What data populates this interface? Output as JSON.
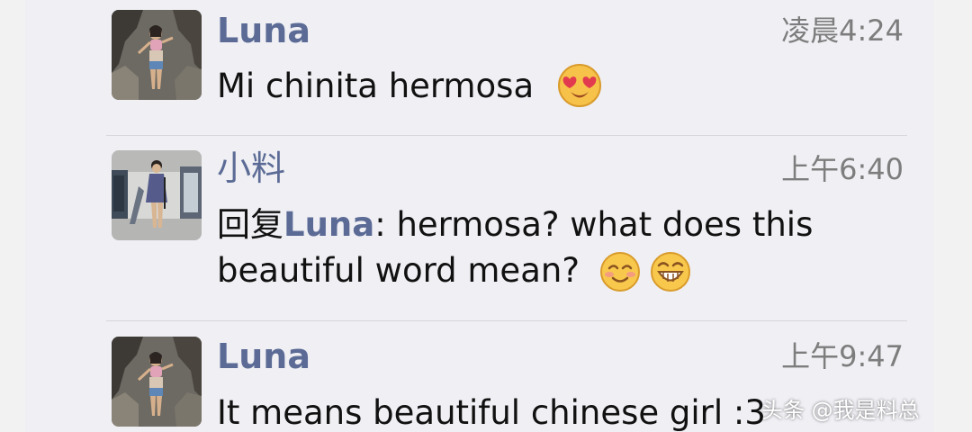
{
  "comments": [
    {
      "author": "Luna",
      "time": "凌晨4:24",
      "text": "Mi chinita hermosa",
      "emojis": [
        "heart-eyes-emoji"
      ]
    },
    {
      "author": "小料",
      "time": "上午6:40",
      "reply_prefix": "回复",
      "reply_to": "Luna",
      "text": ": hermosa?  what does this beautiful word mean?",
      "emojis": [
        "blushing-smile-emoji",
        "grinning-emoji"
      ]
    },
    {
      "author": "Luna",
      "time": "上午9:47",
      "text": "It means beautiful chinese girl :3",
      "emojis": []
    }
  ],
  "watermark": "头条 @我是料总",
  "colors": {
    "background": "#efeff4",
    "name": "#5b6b95",
    "time": "#7d7d7d",
    "text": "#111111"
  }
}
